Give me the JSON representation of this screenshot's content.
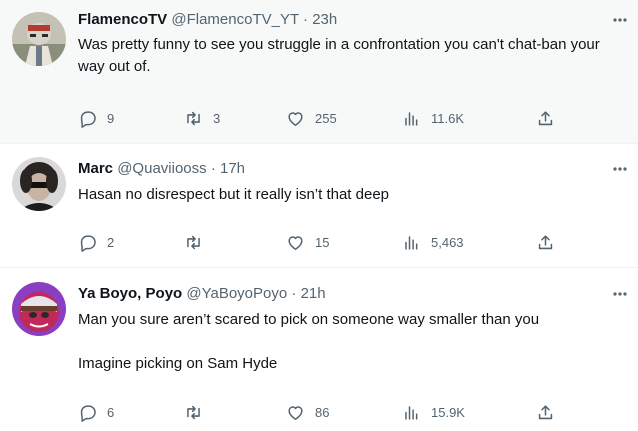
{
  "tweets": [
    {
      "display_name": "FlamencoTV",
      "handle": "@FlamencoTV_YT",
      "separator": "·",
      "time": "23h",
      "text": [
        "Was pretty funny to see you struggle in a confrontation you can't chat-ban your way out of."
      ],
      "replies": "9",
      "retweets": "3",
      "likes": "255",
      "views": "11.6K"
    },
    {
      "display_name": "Marc",
      "handle": "@Quaviiooss",
      "separator": "·",
      "time": "17h",
      "text": [
        "Hasan no disrespect but it really isn’t that deep"
      ],
      "replies": "2",
      "retweets": "",
      "likes": "15",
      "views": "5,463"
    },
    {
      "display_name": "Ya Boyo, Poyo",
      "handle": "@YaBoyoPoyo",
      "separator": "·",
      "time": "21h",
      "text": [
        "Man you sure aren’t scared to pick on someone way smaller than you",
        "Imagine picking on Sam Hyde"
      ],
      "replies": "6",
      "retweets": "",
      "likes": "86",
      "views": "15.9K"
    }
  ],
  "colors": {
    "text_primary": "#0f1419",
    "text_secondary": "#536471",
    "hover_background": "#f7f9f9",
    "divider": "#eff3f4"
  },
  "icons": [
    "reply-icon",
    "retweet-icon",
    "like-icon",
    "views-icon",
    "share-icon",
    "more-icon"
  ]
}
